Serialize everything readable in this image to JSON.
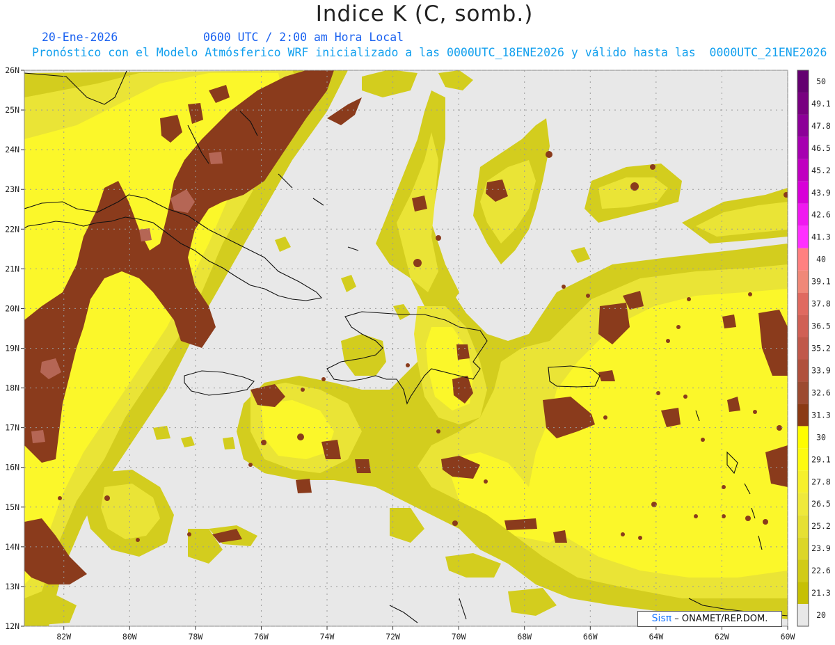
{
  "title": "Indice K (C, somb.)",
  "date": "20-Ene-2026",
  "time": "0600 UTC / 2:00 am Hora Local",
  "forecast": "Pronóstico con el Modelo Atmósferico WRF inicializado a las 0000UTC_18ENE2026 y válido hasta las  0000UTC_21ENE2026",
  "credit": {
    "logo": "Sisπ",
    "text": " – ONAMET/REP.DOM."
  },
  "map": {
    "lon_range": [
      -83.2,
      -60
    ],
    "lat_range": [
      12,
      26
    ],
    "lon_ticks": [
      "82W",
      "80W",
      "78W",
      "76W",
      "74W",
      "72W",
      "70W",
      "68W",
      "66W",
      "64W",
      "62W",
      "60W"
    ],
    "lat_ticks": [
      "12N",
      "13N",
      "14N",
      "15N",
      "16N",
      "17N",
      "18N",
      "19N",
      "20N",
      "21N",
      "22N",
      "23N",
      "24N",
      "25N",
      "26N"
    ],
    "grid": true,
    "background_color": "#e8e8e8",
    "line_color": "#111111"
  },
  "colorbar": {
    "labels": [
      "20",
      "21.3",
      "22.6",
      "23.9",
      "25.2",
      "26.5",
      "27.8",
      "29.1",
      "30",
      "31.3",
      "32.6",
      "33.9",
      "35.2",
      "36.5",
      "37.8",
      "39.1",
      "40",
      "41.3",
      "42.6",
      "43.9",
      "45.2",
      "46.5",
      "47.8",
      "49.1",
      "50"
    ],
    "colors": [
      "#e8e8e8",
      "#c6c003",
      "#d1cb16",
      "#dcd628",
      "#e6e033",
      "#efe93a",
      "#f6f02b",
      "#fdfb10",
      "#fffd00",
      "#8b3a14",
      "#9c4a30",
      "#b0503c",
      "#c0584a",
      "#d06055",
      "#e06a60",
      "#f08878",
      "#ff8080",
      "#ff30ff",
      "#f018f0",
      "#d800d8",
      "#c000c0",
      "#a600b0",
      "#8c0098",
      "#780080",
      "#640070"
    ]
  },
  "levels": {
    "low": "#d3cd1e",
    "mid": "#eae436",
    "high": "#ffff1a",
    "k30": "#8a3b1c",
    "k33": "#b56655"
  }
}
